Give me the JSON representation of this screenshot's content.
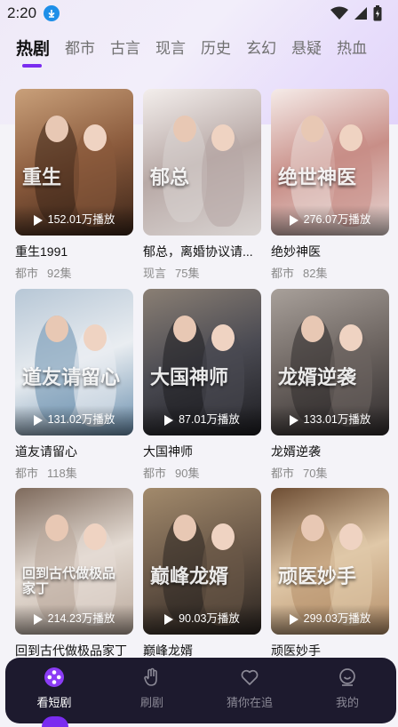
{
  "status_bar": {
    "time": "2:20"
  },
  "tabs": [
    {
      "label": "热剧",
      "active": true
    },
    {
      "label": "都市",
      "active": false
    },
    {
      "label": "古言",
      "active": false
    },
    {
      "label": "现言",
      "active": false
    },
    {
      "label": "历史",
      "active": false
    },
    {
      "label": "玄幻",
      "active": false
    },
    {
      "label": "悬疑",
      "active": false
    },
    {
      "label": "热血",
      "active": false
    }
  ],
  "dramas": [
    {
      "title": "重生1991",
      "genre": "都市",
      "episodes": "92集",
      "plays": "152.01万播放",
      "poster_text": "重生",
      "palette": [
        "#3a2418",
        "#8a5a3c",
        "#c9a07a"
      ]
    },
    {
      "title": "郁总，离婚协议请...",
      "genre": "现言",
      "episodes": "75集",
      "plays": "",
      "poster_text": "郁总",
      "palette": [
        "#d9d4d2",
        "#b8a9a6",
        "#f3eeec"
      ]
    },
    {
      "title": "绝妙神医",
      "genre": "都市",
      "episodes": "82集",
      "plays": "276.07万播放",
      "poster_text": "绝世神医",
      "palette": [
        "#e9d9d6",
        "#c88e87",
        "#f5ebe8"
      ]
    },
    {
      "title": "道友请留心",
      "genre": "都市",
      "episodes": "118集",
      "plays": "131.02万播放",
      "poster_text": "道友请留心",
      "palette": [
        "#6a8fae",
        "#e9edf1",
        "#b7c7d6"
      ]
    },
    {
      "title": "大国神师",
      "genre": "都市",
      "episodes": "90集",
      "plays": "87.01万播放",
      "poster_text": "大国神师",
      "palette": [
        "#1d1d21",
        "#4a4a52",
        "#8a7f74"
      ]
    },
    {
      "title": "龙婿逆袭",
      "genre": "都市",
      "episodes": "70集",
      "plays": "133.01万播放",
      "poster_text": "龙婿逆袭",
      "palette": [
        "#2f2b2c",
        "#6c6460",
        "#a8a09a"
      ]
    },
    {
      "title": "回到古代做极品家丁",
      "genre": "",
      "episodes": "",
      "plays": "214.23万播放",
      "poster_text": "回到古代做极品家丁",
      "palette": [
        "#b9a89b",
        "#e4dbd3",
        "#7e6a5c"
      ]
    },
    {
      "title": "巅峰龙婿",
      "genre": "",
      "episodes": "",
      "plays": "90.03万播放",
      "poster_text": "巅峰龙婿",
      "palette": [
        "#2a2420",
        "#6a5848",
        "#a28a6c"
      ]
    },
    {
      "title": "顽医妙手",
      "genre": "",
      "episodes": "",
      "plays": "299.03万播放",
      "poster_text": "顽医妙手",
      "palette": [
        "#b48e68",
        "#e0c8a8",
        "#6e4e34"
      ]
    }
  ],
  "bottom_nav": [
    {
      "label": "看短剧",
      "icon": "film-reel-icon",
      "active": true
    },
    {
      "label": "刷剧",
      "icon": "swipe-hand-icon",
      "active": false
    },
    {
      "label": "猜你在追",
      "icon": "heart-icon",
      "active": false
    },
    {
      "label": "我的",
      "icon": "profile-smile-icon",
      "active": false
    }
  ]
}
